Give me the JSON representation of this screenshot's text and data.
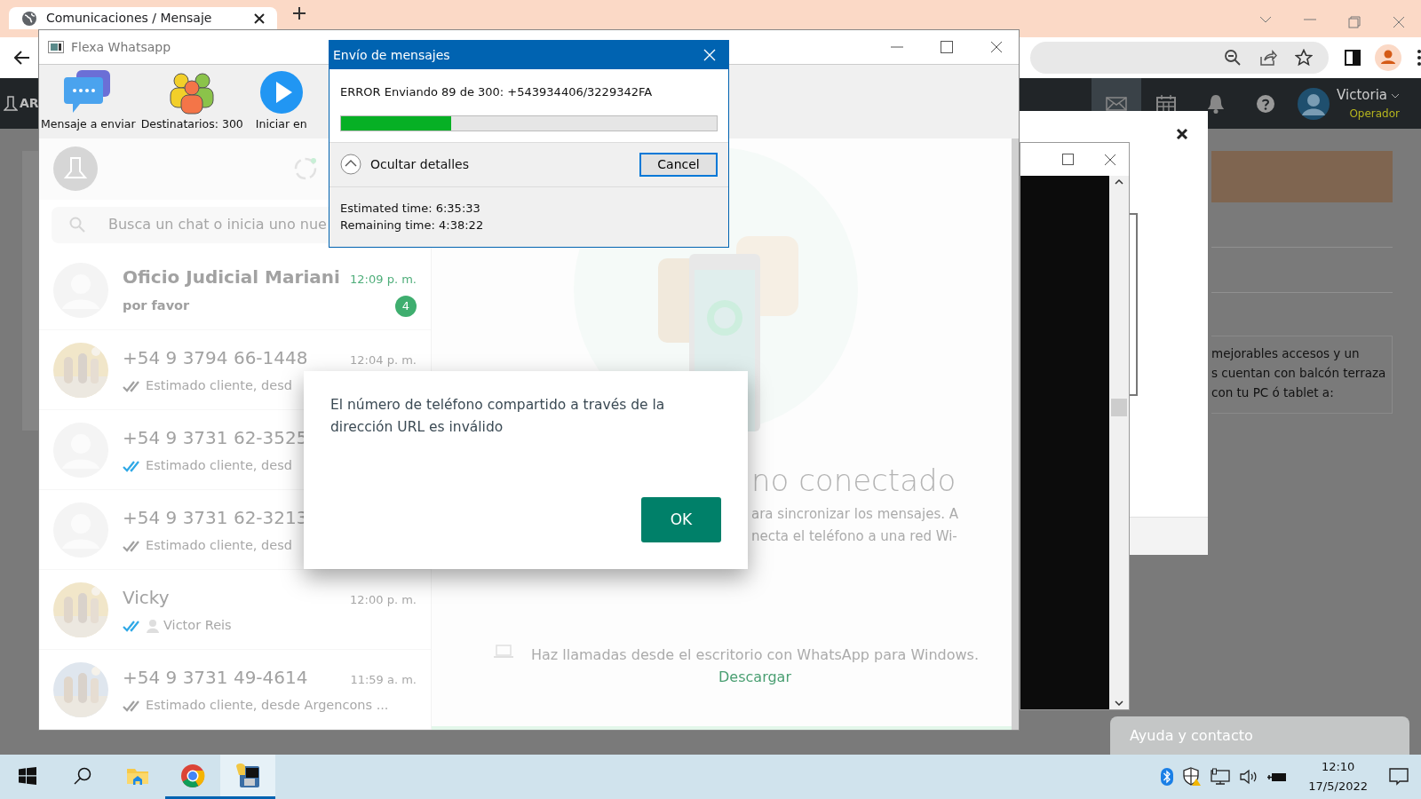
{
  "browser": {
    "tab_title": "Comunicaciones / Mensaje",
    "logo_text": "AR",
    "user": {
      "name": "Victoria",
      "role": "Operador"
    }
  },
  "page": {
    "snippet_lines": [
      "mejorables accesos y un",
      "s cuentan con balcón terraza",
      "con tu PC ó tablet a:"
    ],
    "help_widget": "Ayuda y contacto"
  },
  "flexa_window": {
    "title": "Flexa Whatsapp",
    "toolbar": [
      {
        "kind": "message",
        "label": "Mensaje a enviar"
      },
      {
        "kind": "recipients",
        "label": "Destinatarios: 300"
      },
      {
        "kind": "start",
        "label": "Iniciar en"
      }
    ]
  },
  "whatsapp": {
    "search": {
      "placeholder": "Busca un chat o inicia uno nue"
    },
    "chats": [
      {
        "photo": false,
        "name": "Oficio Judicial Mariani",
        "time": "12:09 p. m.",
        "message": "por favor",
        "unread": "4",
        "delivered": false
      },
      {
        "photo": true,
        "name": "+54 9 3794 66-1448",
        "time": "12:04 p. m.",
        "message": "Estimado cliente, desd",
        "delivered": true,
        "read": false
      },
      {
        "photo": false,
        "name": "+54 9 3731 62-3525",
        "message": "Estimado cliente, desd",
        "delivered": true,
        "read": true
      },
      {
        "photo": false,
        "name": "+54 9 3731 62-3213",
        "message": "Estimado cliente, desd",
        "delivered": true,
        "read": false
      },
      {
        "photo": true,
        "name": "Vicky",
        "time": "12:00 p. m.",
        "message": "Victor Reis",
        "delivered": true,
        "read": true,
        "contact_icon": true
      },
      {
        "photo": true,
        "name": "+54 9 3731 49-4614",
        "time": "11:59 a. m.",
        "message": "Estimado cliente, desde Argencons ...",
        "delivered": true,
        "read": false
      }
    ],
    "main": {
      "title": "no conectado",
      "lines": [
        "ara sincronizar los mensajes. A",
        "necta el teléfono a una red Wi-"
      ],
      "promo": "Haz llamadas desde el escritorio con WhatsApp para Windows.",
      "promo_link": "Descargar"
    }
  },
  "progress_dialog": {
    "title": "Envío de mensajes",
    "status": "ERROR Enviando 89 de 300: +543934406/3229342FA",
    "level": 0.294,
    "details_toggle": "Ocultar detalles",
    "cancel": "Cancel",
    "estimated": "Estimated time: 6:35:33",
    "remaining": "Remaining time: 4:38:22"
  },
  "alert": {
    "message": "El número de teléfono compartido a través de la dirección URL es inválido",
    "button": "OK"
  },
  "taskbar": {
    "apps": [
      {
        "kind": "start",
        "running": false,
        "selected": false
      },
      {
        "kind": "search",
        "running": false,
        "selected": false
      },
      {
        "kind": "explorer",
        "running": false,
        "selected": false
      },
      {
        "kind": "chrome",
        "running": true,
        "selected": false
      },
      {
        "kind": "app",
        "running": true,
        "selected": true
      }
    ],
    "time": "12:10",
    "date": "17/5/2022"
  }
}
